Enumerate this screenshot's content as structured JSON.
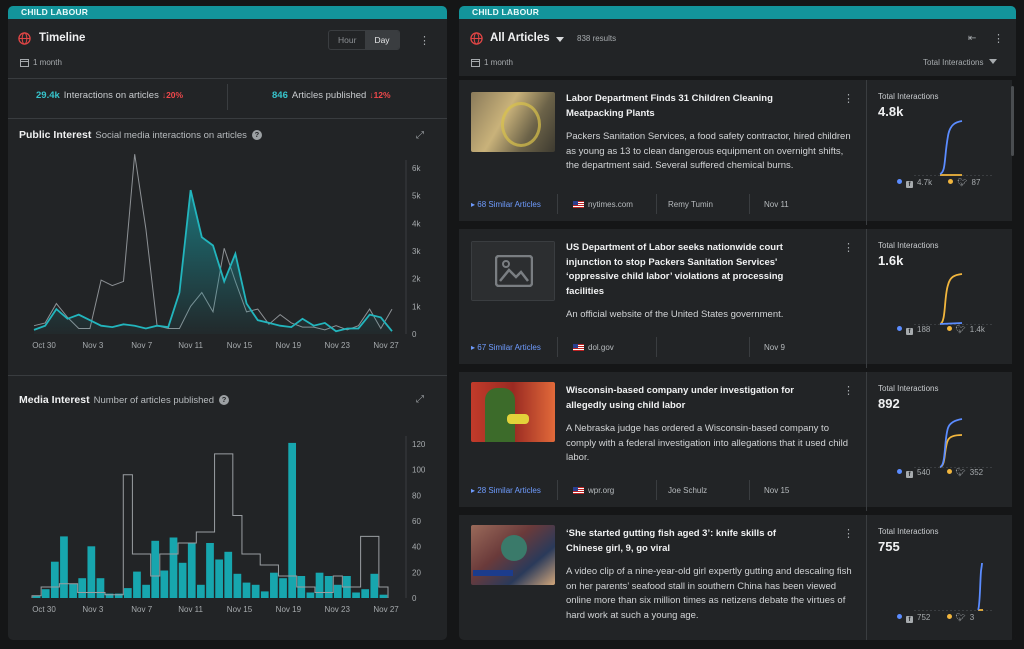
{
  "left": {
    "topic": "CHILD LABOUR",
    "title": "Timeline",
    "range": "1 month",
    "toggle": {
      "hour": "Hour",
      "day": "Day"
    },
    "stats": {
      "interactions": {
        "value": "29.4k",
        "label": "Interactions on articles",
        "change": "20%"
      },
      "articles": {
        "value": "846",
        "label": "Articles published",
        "change": "12%"
      }
    },
    "public": {
      "title": "Public Interest",
      "subtitle": "Social media interactions on articles"
    },
    "media": {
      "title": "Media Interest",
      "subtitle": "Number of articles published"
    }
  },
  "right": {
    "topic": "CHILD LABOUR",
    "title": "All Articles",
    "results": "838 results",
    "range": "1 month",
    "sort": "Total Interactions",
    "total_label": "Total Interactions",
    "articles": [
      {
        "title": "Labor Department Finds 31 Children Cleaning Meatpacking Plants",
        "desc": "Packers Sanitation Services, a food safety contractor, hired children as young as 13 to clean dangerous equipment on overnight shifts, the department said. Several suffered chemical burns.",
        "similar": "68 Similar Articles",
        "source": "nytimes.com",
        "author": "Remy Tumin",
        "date": "Nov 11",
        "total": "4.8k",
        "fb": "4.7k",
        "tw": "87"
      },
      {
        "title": "US Department of Labor seeks nationwide court injunction to stop Packers Sanitation Services' ‘oppressive child labor’ violations at processing facilities",
        "desc": "An official website of the United States government.",
        "similar": "67 Similar Articles",
        "source": "dol.gov",
        "author": "",
        "date": "Nov 9",
        "total": "1.6k",
        "fb": "188",
        "tw": "1.4k"
      },
      {
        "title": "Wisconsin-based company under investigation for allegedly using child labor",
        "desc": "A Nebraska judge has ordered a Wisconsin-based company to comply with a federal investigation into allegations that it used child labor.",
        "similar": "28 Similar Articles",
        "source": "wpr.org",
        "author": "Joe Schulz",
        "date": "Nov 15",
        "total": "892",
        "fb": "540",
        "tw": "352"
      },
      {
        "title": "‘She started gutting fish aged 3’: knife skills of Chinese girl, 9, go viral",
        "desc": "A video clip of a nine-year-old girl expertly gutting and descaling fish on her parents’ seafood stall in southern China has been viewed online more than six million times as netizens debate the virtues of hard work at such a young age.",
        "similar": "",
        "source": "",
        "author": "",
        "date": "",
        "total": "755",
        "fb": "752",
        "tw": "3"
      }
    ]
  },
  "colors": {
    "accent": "#13949b",
    "teal": "#22b5bd",
    "red": "#f0484b",
    "facebook": "#5b8cff",
    "twitter": "#f2b63d"
  },
  "chart_data": [
    {
      "type": "area",
      "title": "Public Interest",
      "subtitle": "Social media interactions on articles",
      "categories": [
        "Oct 30",
        "Nov 3",
        "Nov 7",
        "Nov 11",
        "Nov 15",
        "Nov 19",
        "Nov 23",
        "Nov 27"
      ],
      "ylim": [
        0,
        6000
      ],
      "yticks": [
        "0",
        "1k",
        "2k",
        "3k",
        "4k",
        "5k",
        "6k"
      ],
      "series": [
        {
          "values": [
            150,
            300,
            900,
            550,
            700,
            500,
            300,
            250,
            350,
            300,
            200,
            300,
            250,
            1500,
            5200,
            3500,
            3200,
            1900,
            2900,
            1100,
            500,
            400,
            300,
            250,
            550,
            300,
            400,
            100,
            200,
            200,
            700,
            600,
            100
          ]
        },
        {
          "values": [
            300,
            400,
            1100,
            600,
            200,
            200,
            1950,
            1750,
            1900,
            6500,
            3800,
            300,
            200,
            200,
            1000,
            1500,
            800,
            3100,
            1900,
            800,
            900,
            350,
            700,
            400,
            250,
            250,
            150,
            300,
            150,
            300,
            900,
            200,
            900
          ]
        }
      ]
    },
    {
      "type": "bar",
      "title": "Media Interest",
      "subtitle": "Number of articles published",
      "categories": [
        "Oct 30",
        "Nov 3",
        "Nov 7",
        "Nov 11",
        "Nov 15",
        "Nov 19",
        "Nov 23",
        "Nov 27"
      ],
      "ylim": [
        0,
        140
      ],
      "yticks": [
        "0",
        "20",
        "40",
        "60",
        "80",
        "100",
        "120"
      ],
      "series": [
        {
          "values": [
            2,
            8,
            33,
            56,
            13,
            18,
            47,
            18,
            4,
            4,
            9,
            24,
            12,
            52,
            25,
            55,
            32,
            50,
            12,
            50,
            35,
            42,
            22,
            14,
            12,
            6,
            23,
            18,
            141,
            20,
            5,
            23,
            20,
            12,
            20,
            5,
            8,
            22,
            3
          ]
        },
        {
          "values": [
            2,
            10,
            10,
            13,
            13,
            5,
            5,
            5,
            3,
            3,
            112,
            40,
            40,
            20,
            40,
            40,
            50,
            50,
            60,
            60,
            131,
            131,
            75,
            40,
            40,
            30,
            30,
            20,
            20,
            10,
            10,
            5,
            5,
            20,
            10,
            10,
            56,
            56,
            10
          ]
        }
      ]
    }
  ]
}
